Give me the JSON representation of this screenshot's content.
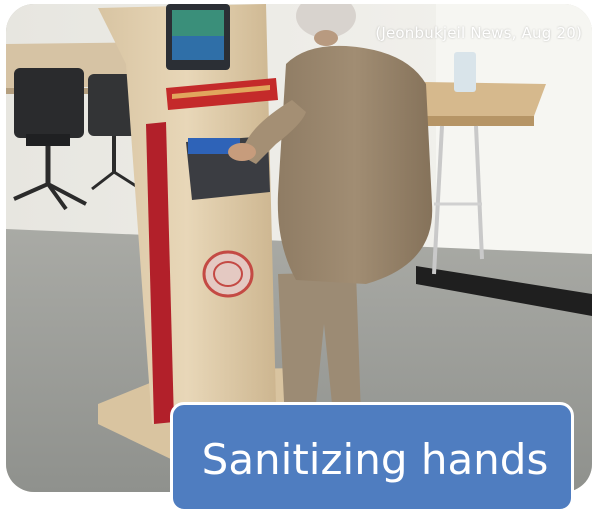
{
  "photo": {
    "credit": "(Jeonbukjeil News, Aug 20)"
  },
  "caption": {
    "text": "Sanitizing hands"
  }
}
